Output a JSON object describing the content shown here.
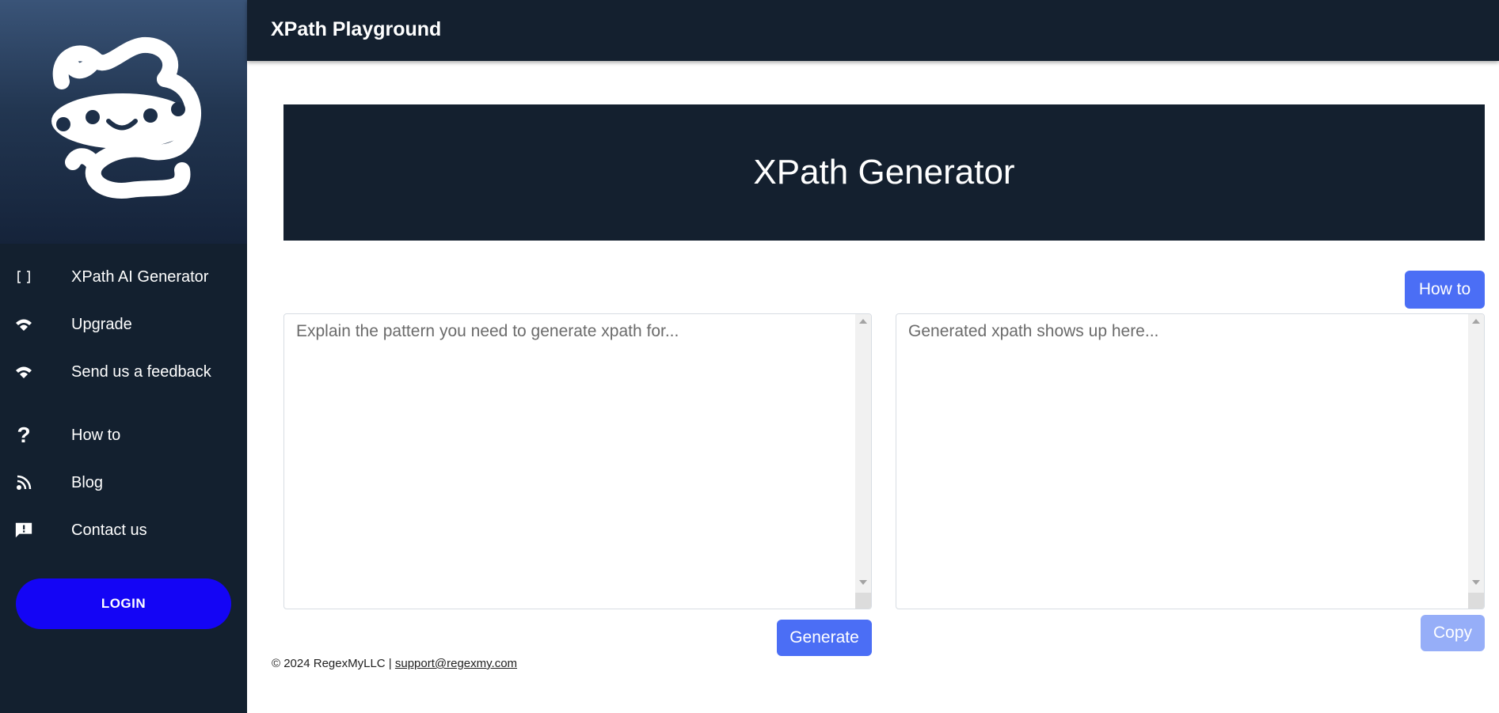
{
  "app": {
    "title": "XPath Playground"
  },
  "sidebar": {
    "logo_icon": "octopus-logo",
    "items": [
      {
        "label": "XPath AI Generator",
        "icon": "brackets-icon"
      },
      {
        "label": "Upgrade",
        "icon": "wifi-icon"
      },
      {
        "label": "Send us a feedback",
        "icon": "wifi-icon"
      },
      {
        "label": "How to",
        "icon": "question-icon"
      },
      {
        "label": "Blog",
        "icon": "rss-icon"
      },
      {
        "label": "Contact us",
        "icon": "feedback-icon"
      }
    ],
    "login_label": "LOGIN",
    "login_color": "#1405f5"
  },
  "main": {
    "banner_title": "XPath Generator",
    "howto_button": "How to",
    "input": {
      "placeholder": "Explain the pattern you need to generate xpath for...",
      "value": ""
    },
    "output": {
      "placeholder": "Generated xpath shows up here...",
      "value": ""
    },
    "generate_button": "Generate",
    "copy_button": "Copy",
    "accent_color": "#4b6ef5"
  },
  "footer": {
    "copyright": "© 2024 RegexMyLLC | ",
    "email": "support@regexmy.com"
  }
}
